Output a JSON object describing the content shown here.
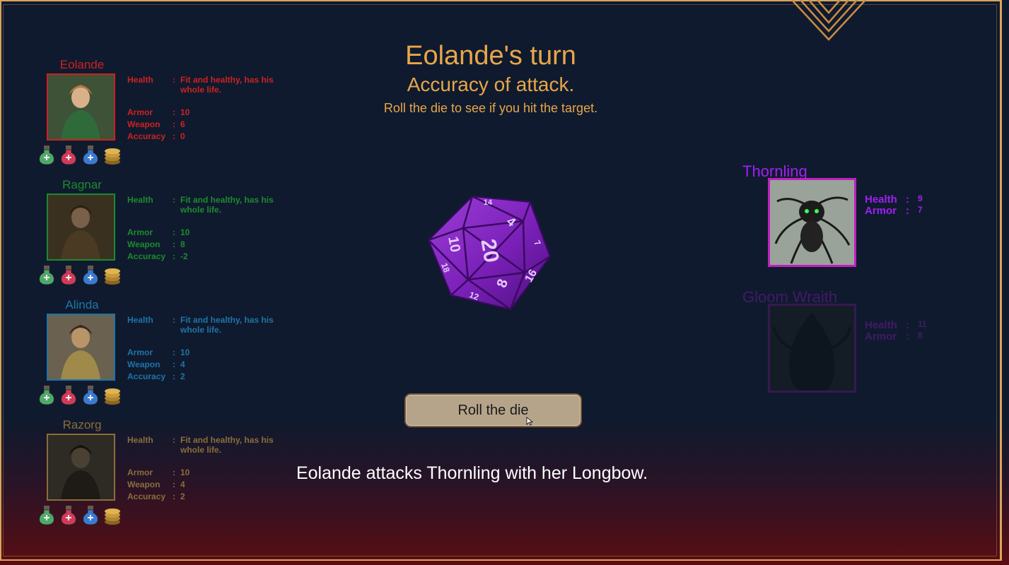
{
  "colors": {
    "eolande": "#cc2222",
    "ragnar": "#1e8a2e",
    "alinda": "#1f74a8",
    "razorg": "#8a6e3a",
    "thornling": "#a020f0",
    "gloom_wraith": "#8a1ab8",
    "accent": "#e8a64a",
    "frame": "#d9a45a"
  },
  "turn": {
    "title": "Eolande's turn",
    "subtitle": "Accuracy of attack.",
    "instruction": "Roll the die to see if you hit the target."
  },
  "party": [
    {
      "name": "Eolande",
      "health_label": "Health",
      "health": "Fit and healthy, has his whole life.",
      "armor_label": "Armor",
      "armor": "10",
      "weapon_label": "Weapon",
      "weapon": "6",
      "accuracy_label": "Accuracy",
      "accuracy": "0",
      "sep": ":",
      "items": [
        "green-potion-icon",
        "red-potion-icon",
        "blue-potion-icon",
        "gold-coins-icon"
      ]
    },
    {
      "name": "Ragnar",
      "health_label": "Health",
      "health": "Fit and healthy, has his whole life.",
      "armor_label": "Armor",
      "armor": "10",
      "weapon_label": "Weapon",
      "weapon": "8",
      "accuracy_label": "Accuracy",
      "accuracy": "-2",
      "sep": ":",
      "items": [
        "green-potion-icon",
        "red-potion-icon",
        "blue-potion-icon",
        "gold-coins-icon"
      ]
    },
    {
      "name": "Alinda",
      "health_label": "Health",
      "health": "Fit and healthy, has his whole life.",
      "armor_label": "Armor",
      "armor": "10",
      "weapon_label": "Weapon",
      "weapon": "4",
      "accuracy_label": "Accuracy",
      "accuracy": "2",
      "sep": ":",
      "items": [
        "green-potion-icon",
        "red-potion-icon",
        "blue-potion-icon",
        "gold-coins-icon"
      ]
    },
    {
      "name": "Razorg",
      "health_label": "Health",
      "health": "Fit and healthy, has his whole life.",
      "armor_label": "Armor",
      "armor": "10",
      "weapon_label": "Weapon",
      "weapon": "4",
      "accuracy_label": "Accuracy",
      "accuracy": "2",
      "sep": ":",
      "items": [
        "green-potion-icon",
        "red-potion-icon",
        "blue-potion-icon",
        "gold-coins-icon"
      ]
    }
  ],
  "enemies": [
    {
      "name": "Thornling",
      "health_label": "Health",
      "health": "9",
      "armor_label": "Armor",
      "armor": "7",
      "sep": ":",
      "state": "active"
    },
    {
      "name": "Gloom Wraith",
      "health_label": "Health",
      "health": "11",
      "armor_label": "Armor",
      "armor": "8",
      "sep": ":",
      "state": "inactive"
    }
  ],
  "die": {
    "type": "d20",
    "faces": [
      "20",
      "8",
      "10",
      "4",
      "16",
      "14",
      "12",
      "7",
      "18"
    ]
  },
  "roll_button": "Roll the die",
  "narration": "Eolande attacks Thornling with her Longbow."
}
